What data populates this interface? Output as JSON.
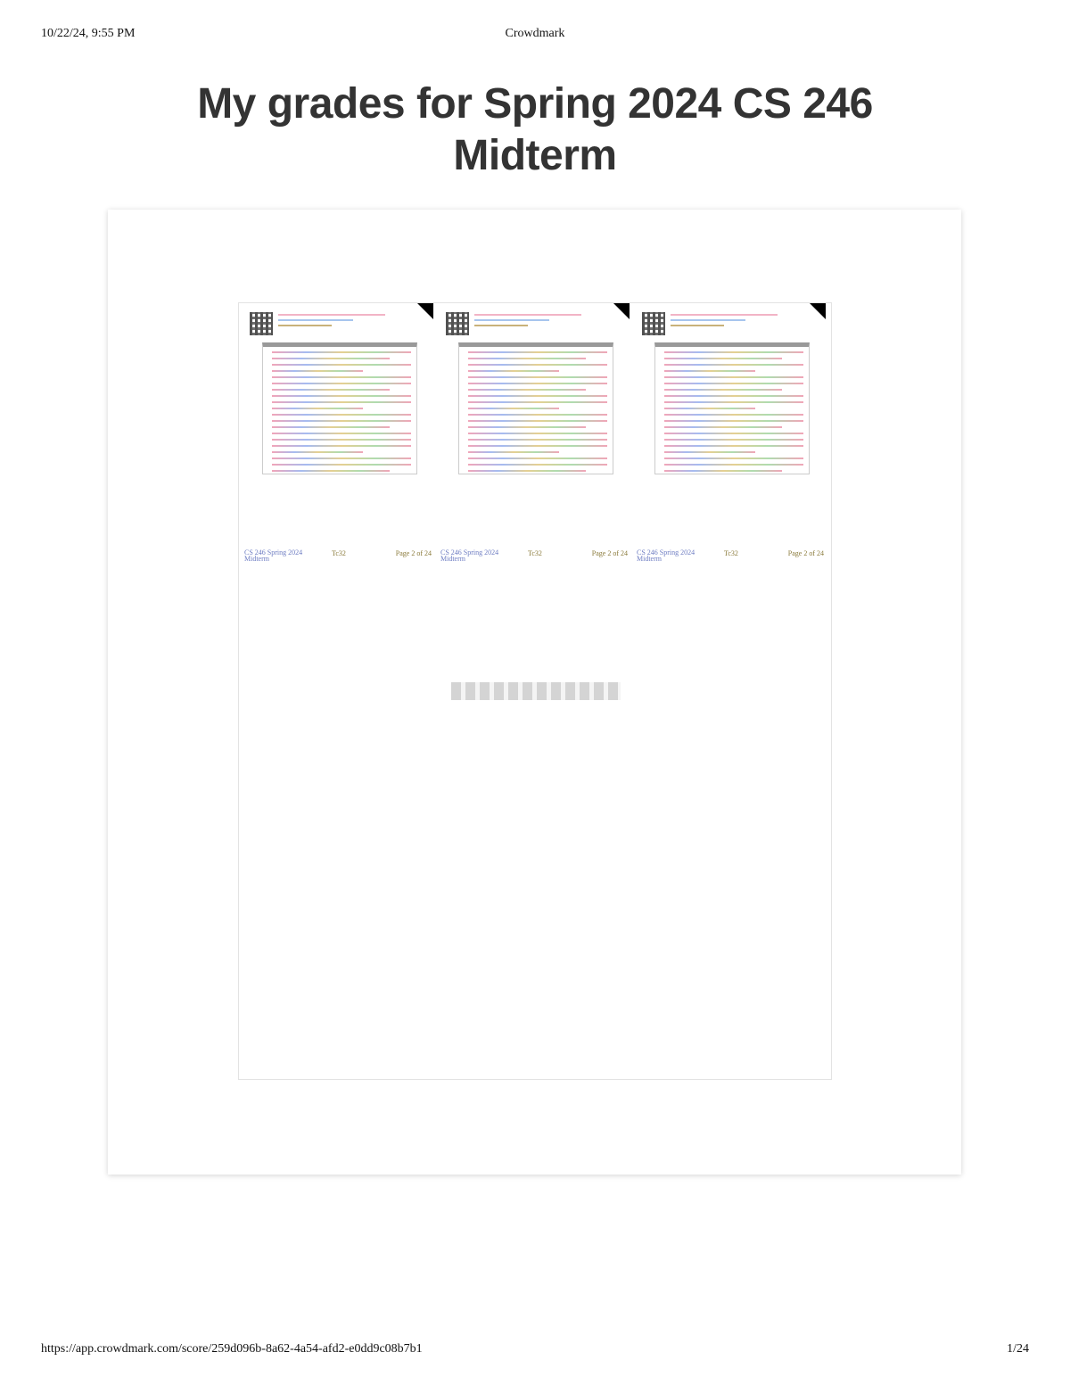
{
  "print_header": {
    "datetime": "10/22/24, 9:55 PM",
    "site": "Crowdmark"
  },
  "page": {
    "title": "My grades for Spring 2024 CS 246 Midterm"
  },
  "viewer": {
    "pages": [
      {
        "footer_left": "CS 246 Spring 2024 Midterm",
        "footer_mid": "Tc32",
        "footer_right": "Page 2 of 24"
      },
      {
        "footer_left": "CS 246 Spring 2024 Midterm",
        "footer_mid": "Tc32",
        "footer_right": "Page 2 of 24"
      },
      {
        "footer_left": "CS 246 Spring 2024 Midterm",
        "footer_mid": "Tc32",
        "footer_right": "Page 2 of 24"
      }
    ],
    "loading": true
  },
  "print_footer": {
    "url": "https://app.crowdmark.com/score/259d096b-8a62-4a54-afd2-e0dd9c08b7b1",
    "page_count": "1/24"
  }
}
